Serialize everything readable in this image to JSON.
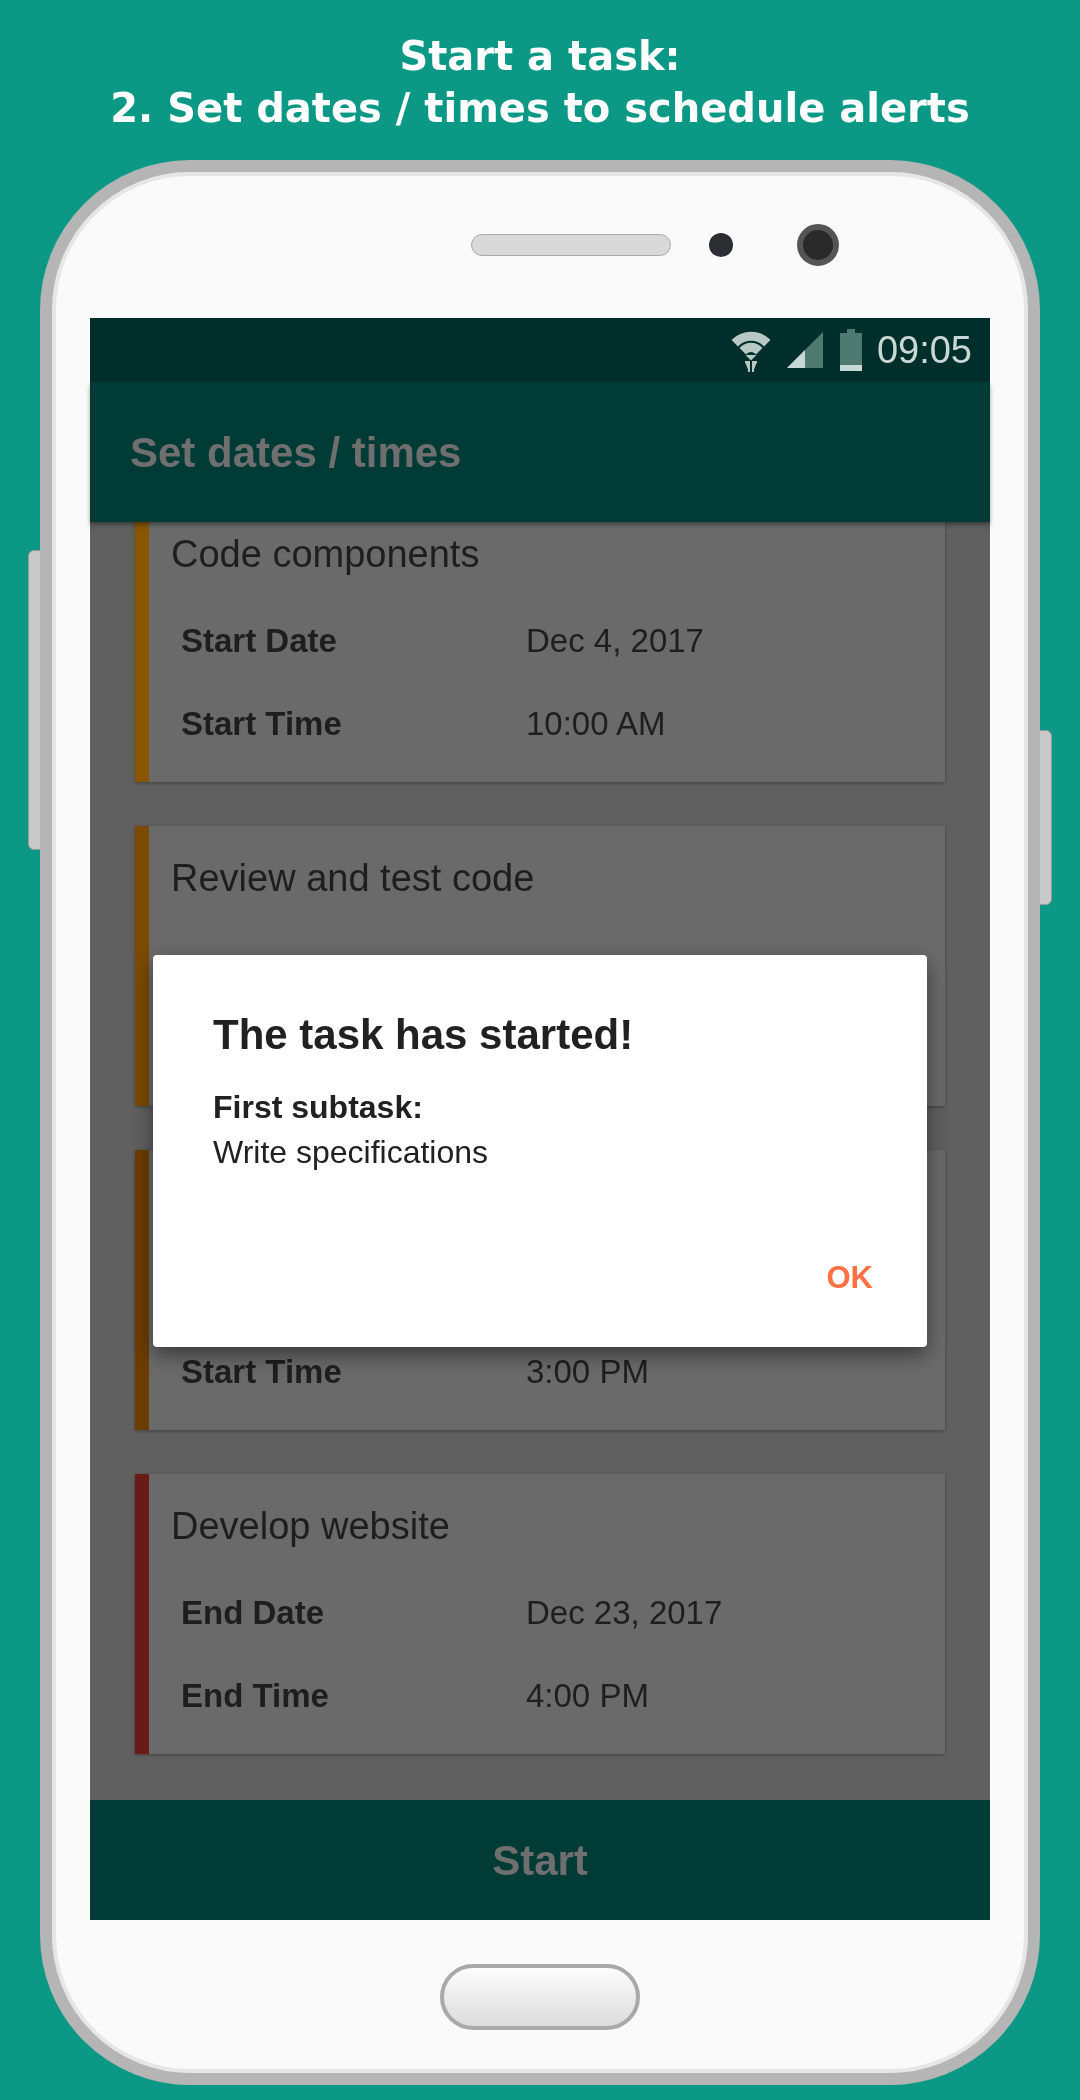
{
  "caption": {
    "lines": [
      "Start a task:",
      "2. Set dates / times to schedule alerts"
    ]
  },
  "status_bar": {
    "time": "09:05"
  },
  "app_bar": {
    "title": "Set dates / times"
  },
  "cards": [
    {
      "color": "#8a5600",
      "title": "Code components",
      "fields": [
        {
          "label": "Start Date",
          "value": "Dec 4, 2017"
        },
        {
          "label": "Start Time",
          "value": "10:00 AM"
        }
      ]
    },
    {
      "color": "#7c4a00",
      "title": "Review and test code"
    },
    {
      "color": "#6b3d00",
      "fields": [
        {
          "label": "Start Time",
          "value": "3:00 PM"
        }
      ]
    },
    {
      "color": "#6b1b16",
      "title": "Develop website",
      "fields": [
        {
          "label": "End Date",
          "value": "Dec 23, 2017"
        },
        {
          "label": "End Time",
          "value": "4:00 PM"
        }
      ]
    }
  ],
  "dialog": {
    "title": "The task has started!",
    "label": "First subtask:",
    "text": "Write specifications",
    "button": "OK"
  },
  "bottom_button": "Start"
}
